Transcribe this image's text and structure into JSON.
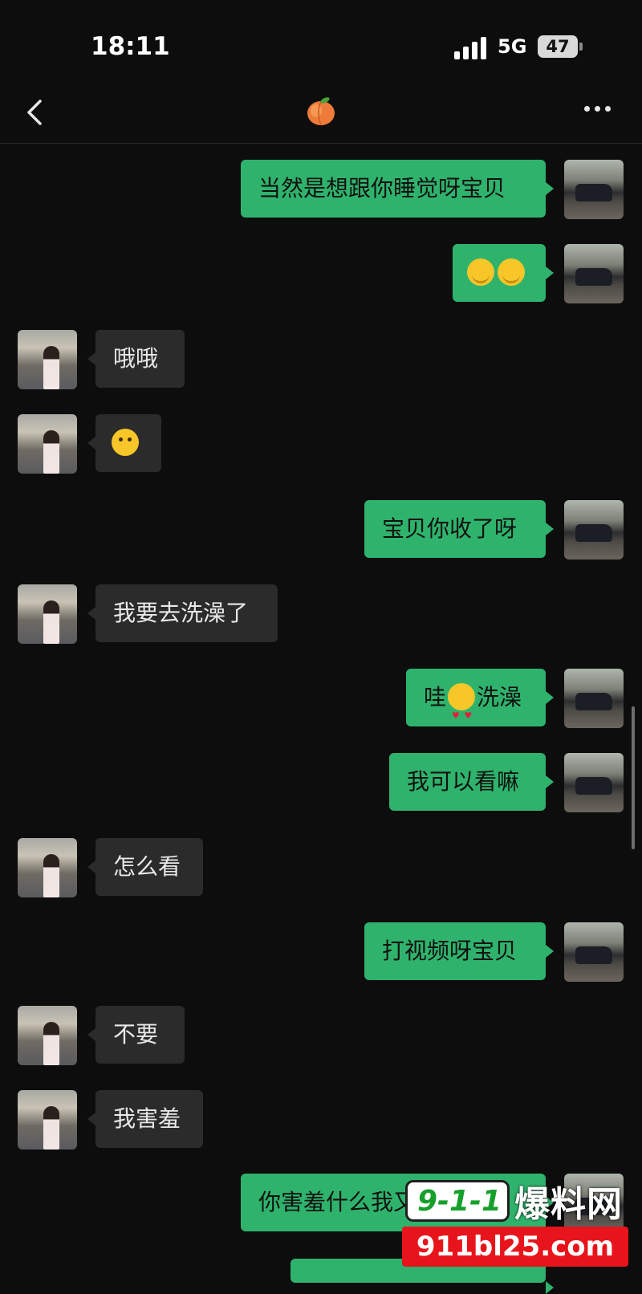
{
  "status_bar": {
    "time": "18:11",
    "network": "5G",
    "battery": "47"
  },
  "nav": {
    "title_icon": "peach-icon",
    "back_icon": "chevron-left-icon",
    "menu_icon": "more-dots-icon"
  },
  "messages": [
    {
      "side": "out",
      "text": "当然是想跟你睡觉呀宝贝"
    },
    {
      "side": "out",
      "text": "",
      "emoji": "hug-emoji-x2"
    },
    {
      "side": "in",
      "text": "哦哦"
    },
    {
      "side": "in",
      "text": "",
      "emoji": "smile-emoji"
    },
    {
      "side": "out",
      "text": "宝贝你收了呀"
    },
    {
      "side": "in",
      "text": "我要去洗澡了"
    },
    {
      "side": "out",
      "text_before": "哇",
      "text_after": "洗澡",
      "emoji": "heart-eyes-emoji"
    },
    {
      "side": "out",
      "text": "我可以看嘛"
    },
    {
      "side": "in",
      "text": "怎么看"
    },
    {
      "side": "out",
      "text": "打视频呀宝贝"
    },
    {
      "side": "in",
      "text": "不要"
    },
    {
      "side": "in",
      "text": "我害羞"
    },
    {
      "side": "out",
      "text": "你害羞什么我又"
    }
  ],
  "watermark": {
    "logo": "9-1-1",
    "title": "爆料网",
    "url": "911bl25.com"
  },
  "colors": {
    "outgoing": "#2fb36c",
    "incoming": "#2b2b2b",
    "background": "#0d0d0d",
    "watermark_red": "#e8141b"
  }
}
